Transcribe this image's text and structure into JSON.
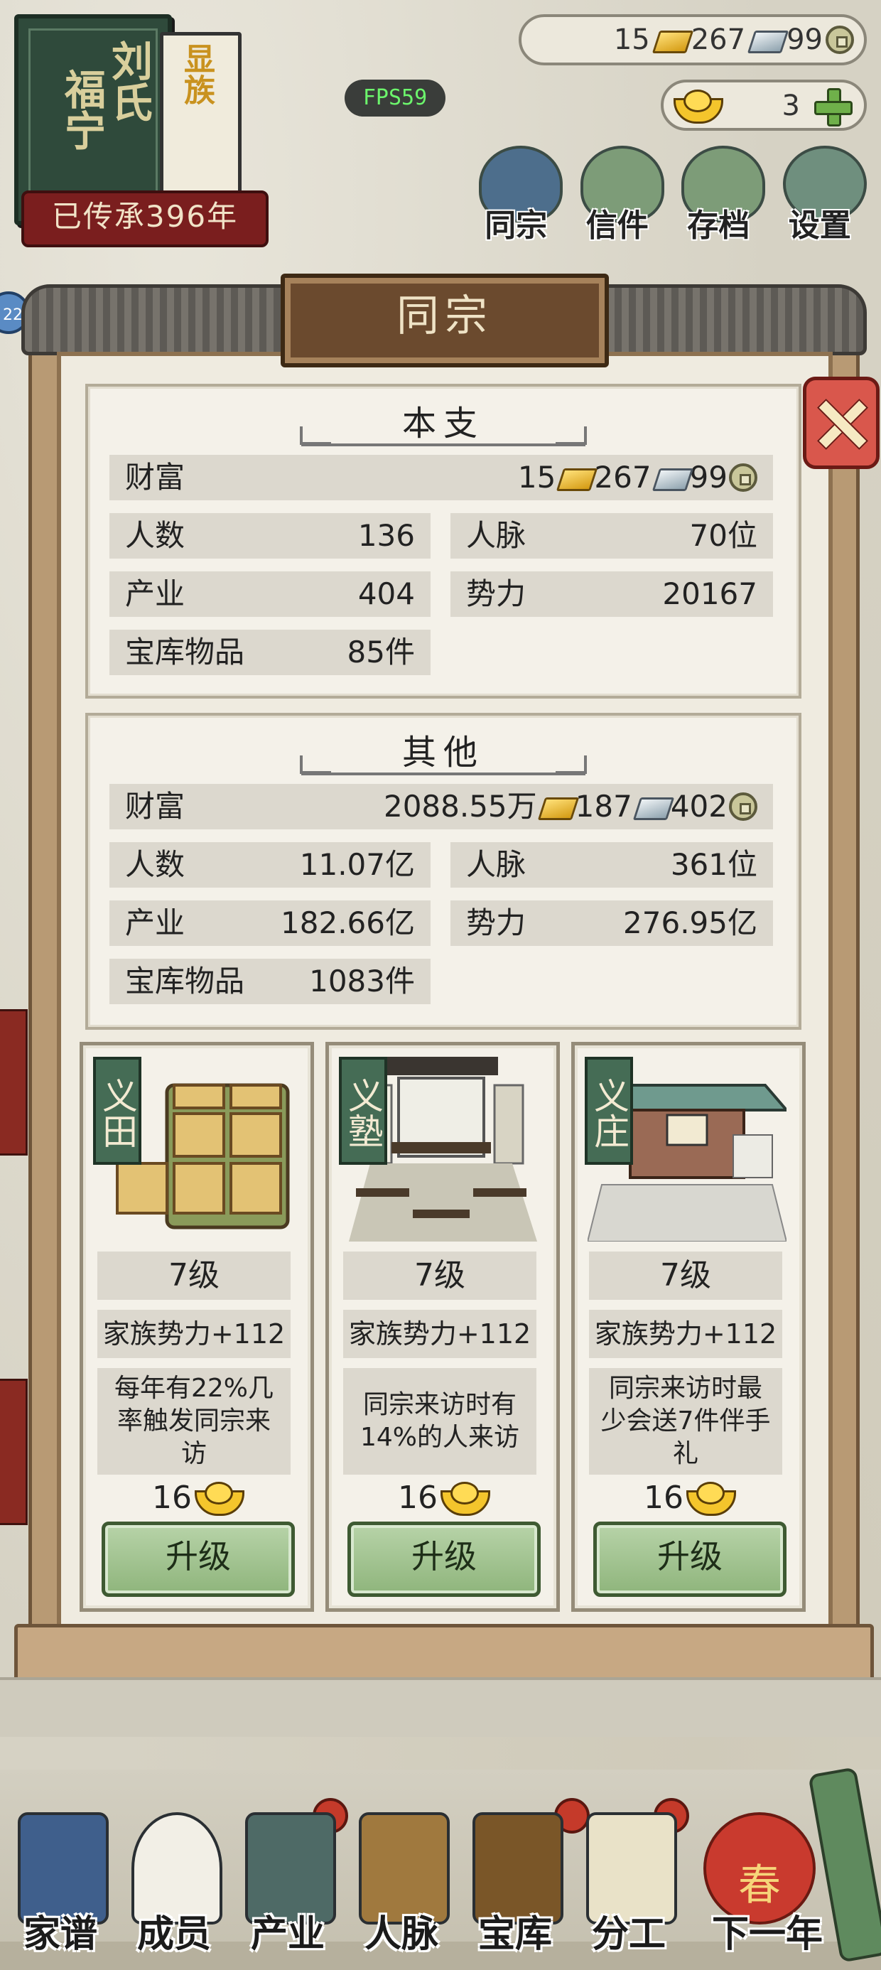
{
  "hud": {
    "clan_name": "刘氏",
    "clan_place": "福宁",
    "clan_tag": "显族",
    "inherited": "已传承396年",
    "fps": "FPS59",
    "resources": {
      "gold": "15",
      "silver": "267",
      "coin": "99"
    },
    "yuanbao": "3",
    "left_badge": "22"
  },
  "top_menu": [
    {
      "label": "同宗",
      "icon": "clan-book-icon"
    },
    {
      "label": "信件",
      "icon": "letter-icon"
    },
    {
      "label": "存档",
      "icon": "save-brush-icon"
    },
    {
      "label": "设置",
      "icon": "settings-gear-icon"
    }
  ],
  "panel": {
    "title": "同宗",
    "main_branch": {
      "title": "本支",
      "wealth_label": "财富",
      "wealth": {
        "gold": "15",
        "silver": "267",
        "coin": "99"
      },
      "people_label": "人数",
      "people": "136",
      "contacts_label": "人脉",
      "contacts": "70位",
      "industry_label": "产业",
      "industry": "404",
      "power_label": "势力",
      "power": "20167",
      "treasury_label": "宝库物品",
      "treasury": "85件"
    },
    "others": {
      "title": "其他",
      "wealth_label": "财富",
      "wealth": {
        "prefix": "2088.55万",
        "gold": "187",
        "silver": "402"
      },
      "people_label": "人数",
      "people": "11.07亿",
      "contacts_label": "人脉",
      "contacts": "361位",
      "industry_label": "产业",
      "industry": "182.66亿",
      "power_label": "势力",
      "power": "276.95亿",
      "treasury_label": "宝库物品",
      "treasury": "1083件"
    },
    "facilities": [
      {
        "name": "义田",
        "level": "7级",
        "power": "家族势力+112",
        "desc": "每年有22%几率触发同宗来访",
        "cost": "16",
        "button": "升级"
      },
      {
        "name": "义塾",
        "level": "7级",
        "power": "家族势力+112",
        "desc": "同宗来访时有14%的人来访",
        "cost": "16",
        "button": "升级"
      },
      {
        "name": "义庄",
        "level": "7级",
        "power": "家族势力+112",
        "desc": "同宗来访时最少会送7件伴手礼",
        "cost": "16",
        "button": "升级"
      }
    ]
  },
  "bottom_nav": [
    {
      "label": "家谱"
    },
    {
      "label": "成员"
    },
    {
      "label": "产业"
    },
    {
      "label": "人脉"
    },
    {
      "label": "宝库"
    },
    {
      "label": "分工"
    },
    {
      "label": "下一年",
      "badge": "春"
    }
  ],
  "colors": {
    "panel_bg": "#efebe0",
    "row_bg": "#dcd8ce",
    "accent_green": "#8fb57c",
    "close_red": "#d9574c",
    "title_wood": "#6b4a2e"
  }
}
